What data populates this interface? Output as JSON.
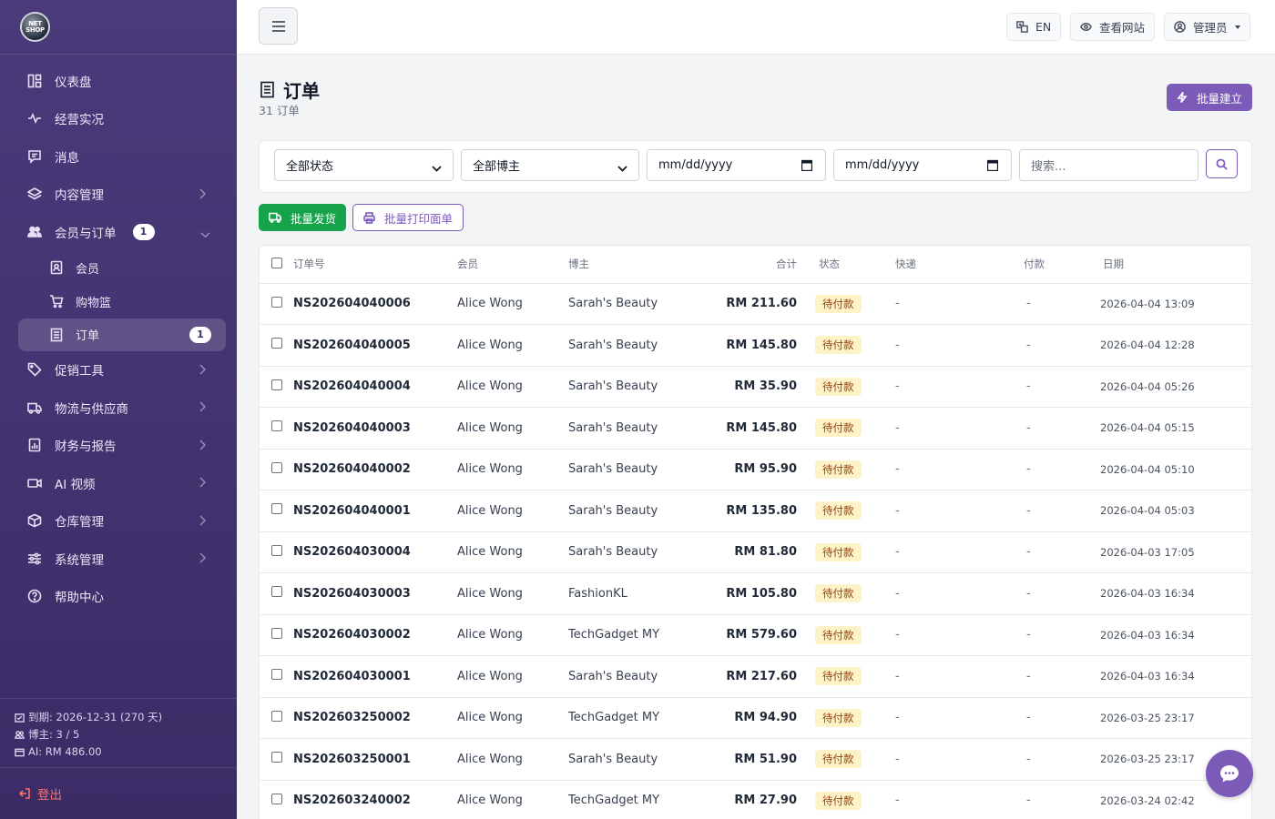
{
  "logo": {
    "text": "NET SHOP"
  },
  "sidebar": {
    "items": [
      {
        "label": "仪表盘",
        "icon": "dashboard-icon"
      },
      {
        "label": "经营实况",
        "icon": "activity-icon"
      },
      {
        "label": "消息",
        "icon": "message-icon"
      },
      {
        "label": "内容管理",
        "icon": "layers-icon",
        "chevron": "right"
      },
      {
        "label": "会员与订单",
        "icon": "users-icon",
        "badge": "1",
        "chevron": "down"
      },
      {
        "label": "促销工具",
        "icon": "tag-icon",
        "chevron": "right"
      },
      {
        "label": "物流与供应商",
        "icon": "truck-icon",
        "chevron": "right"
      },
      {
        "label": "财务与报告",
        "icon": "report-icon",
        "chevron": "right"
      },
      {
        "label": "AI 视频",
        "icon": "video-icon",
        "chevron": "right"
      },
      {
        "label": "仓库管理",
        "icon": "box-icon",
        "chevron": "right"
      },
      {
        "label": "系统管理",
        "icon": "sliders-icon",
        "chevron": "right"
      },
      {
        "label": "帮助中心",
        "icon": "help-icon"
      }
    ],
    "sub_items": [
      {
        "label": "会员",
        "icon": "member-card-icon"
      },
      {
        "label": "购物篮",
        "icon": "cart-icon"
      },
      {
        "label": "订单",
        "icon": "receipt-icon",
        "badge": "1",
        "active": true
      }
    ],
    "footer": {
      "expiry": "到期: 2026-12-31 (270 天)",
      "bloggers": "博主: 3 / 5",
      "ai": "AI: RM 486.00"
    },
    "logout": "登出"
  },
  "topbar": {
    "lang": "EN",
    "view_site": "查看网站",
    "admin": "管理员"
  },
  "page": {
    "title": "订单",
    "subtitle": "31 订单",
    "batch_create": "批量建立"
  },
  "filters": {
    "status": "全部状态",
    "blogger": "全部博主",
    "date_from": "mm/dd/yyyy",
    "date_to": "mm/dd/yyyy",
    "search_placeholder": "搜索..."
  },
  "actions": {
    "batch_ship": "批量发货",
    "batch_print": "批量打印面单"
  },
  "table": {
    "headers": [
      "订单号",
      "会员",
      "博主",
      "合计",
      "状态",
      "快递",
      "付款",
      "日期"
    ],
    "rows": [
      {
        "order": "NS202604040006",
        "member": "Alice Wong",
        "blogger": "Sarah's Beauty",
        "total": "RM 211.60",
        "status": "待付款",
        "courier": "-",
        "payment": "-",
        "date": "2026-04-04 13:09"
      },
      {
        "order": "NS202604040005",
        "member": "Alice Wong",
        "blogger": "Sarah's Beauty",
        "total": "RM 145.80",
        "status": "待付款",
        "courier": "-",
        "payment": "-",
        "date": "2026-04-04 12:28"
      },
      {
        "order": "NS202604040004",
        "member": "Alice Wong",
        "blogger": "Sarah's Beauty",
        "total": "RM 35.90",
        "status": "待付款",
        "courier": "-",
        "payment": "-",
        "date": "2026-04-04 05:26"
      },
      {
        "order": "NS202604040003",
        "member": "Alice Wong",
        "blogger": "Sarah's Beauty",
        "total": "RM 145.80",
        "status": "待付款",
        "courier": "-",
        "payment": "-",
        "date": "2026-04-04 05:15"
      },
      {
        "order": "NS202604040002",
        "member": "Alice Wong",
        "blogger": "Sarah's Beauty",
        "total": "RM 95.90",
        "status": "待付款",
        "courier": "-",
        "payment": "-",
        "date": "2026-04-04 05:10"
      },
      {
        "order": "NS202604040001",
        "member": "Alice Wong",
        "blogger": "Sarah's Beauty",
        "total": "RM 135.80",
        "status": "待付款",
        "courier": "-",
        "payment": "-",
        "date": "2026-04-04 05:03"
      },
      {
        "order": "NS202604030004",
        "member": "Alice Wong",
        "blogger": "Sarah's Beauty",
        "total": "RM 81.80",
        "status": "待付款",
        "courier": "-",
        "payment": "-",
        "date": "2026-04-03 17:05"
      },
      {
        "order": "NS202604030003",
        "member": "Alice Wong",
        "blogger": "FashionKL",
        "total": "RM 105.80",
        "status": "待付款",
        "courier": "-",
        "payment": "-",
        "date": "2026-04-03 16:34"
      },
      {
        "order": "NS202604030002",
        "member": "Alice Wong",
        "blogger": "TechGadget MY",
        "total": "RM 579.60",
        "status": "待付款",
        "courier": "-",
        "payment": "-",
        "date": "2026-04-03 16:34"
      },
      {
        "order": "NS202604030001",
        "member": "Alice Wong",
        "blogger": "Sarah's Beauty",
        "total": "RM 217.60",
        "status": "待付款",
        "courier": "-",
        "payment": "-",
        "date": "2026-04-03 16:34"
      },
      {
        "order": "NS202603250002",
        "member": "Alice Wong",
        "blogger": "TechGadget MY",
        "total": "RM 94.90",
        "status": "待付款",
        "courier": "-",
        "payment": "-",
        "date": "2026-03-25 23:17"
      },
      {
        "order": "NS202603250001",
        "member": "Alice Wong",
        "blogger": "Sarah's Beauty",
        "total": "RM 51.90",
        "status": "待付款",
        "courier": "-",
        "payment": "-",
        "date": "2026-03-25 23:17"
      },
      {
        "order": "NS202603240002",
        "member": "Alice Wong",
        "blogger": "TechGadget MY",
        "total": "RM 27.90",
        "status": "待付款",
        "courier": "-",
        "payment": "-",
        "date": "2026-03-24 02:42"
      }
    ]
  },
  "colors": {
    "sidebar": "#4b3a7a",
    "accent": "#7c5bb8",
    "success": "#16a34a",
    "status_bg": "#fef3c7",
    "logout": "#f87171"
  }
}
